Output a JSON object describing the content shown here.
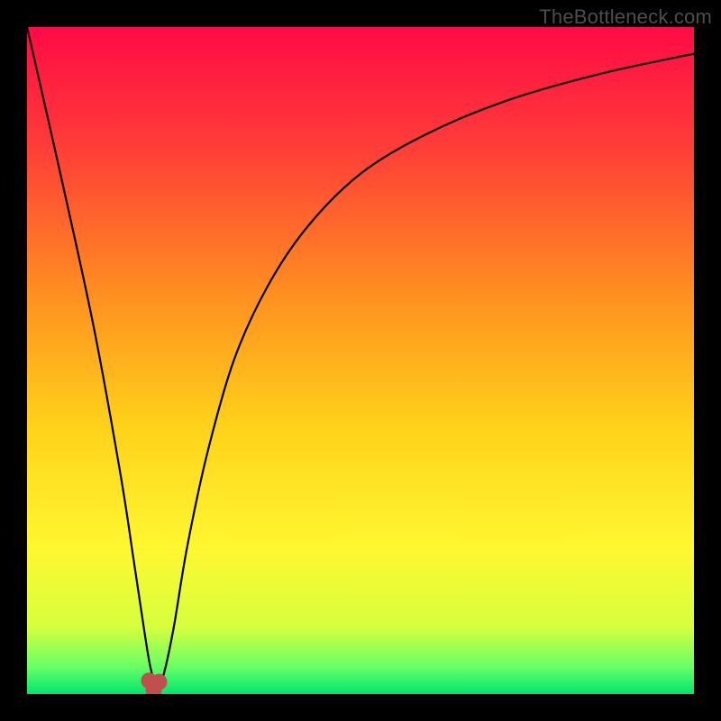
{
  "watermark": "TheBottleneck.com",
  "chart_data": {
    "type": "line",
    "title": "",
    "xlabel": "",
    "ylabel": "",
    "xlim": [
      0,
      100
    ],
    "ylim": [
      0,
      100
    ],
    "series": [
      {
        "name": "bottleneck-curve",
        "x": [
          0,
          5,
          10,
          14,
          16,
          17.5,
          18.5,
          19.5,
          20.5,
          22,
          24,
          27,
          31,
          36,
          42,
          50,
          60,
          72,
          86,
          100
        ],
        "y": [
          100,
          78,
          55,
          33,
          20,
          10,
          4,
          1,
          3,
          10,
          22,
          36,
          50,
          61,
          70,
          78,
          84,
          89,
          93,
          96
        ]
      }
    ],
    "markers": [
      {
        "name": "dip-marker-left",
        "x": 18.3,
        "y": 2.0
      },
      {
        "name": "dip-marker-mid",
        "x": 19.0,
        "y": 0.6
      },
      {
        "name": "dip-marker-right",
        "x": 19.8,
        "y": 1.8
      }
    ],
    "gradient_stops": [
      {
        "pct": 0,
        "color": "#ff0a45"
      },
      {
        "pct": 18,
        "color": "#ff3d38"
      },
      {
        "pct": 40,
        "color": "#ff8f20"
      },
      {
        "pct": 60,
        "color": "#ffd21a"
      },
      {
        "pct": 78,
        "color": "#fff730"
      },
      {
        "pct": 90,
        "color": "#d6ff3d"
      },
      {
        "pct": 96,
        "color": "#66ff66"
      },
      {
        "pct": 100,
        "color": "#00e66e"
      }
    ],
    "marker_color": "#c0504d",
    "curve_color": "#000000"
  }
}
